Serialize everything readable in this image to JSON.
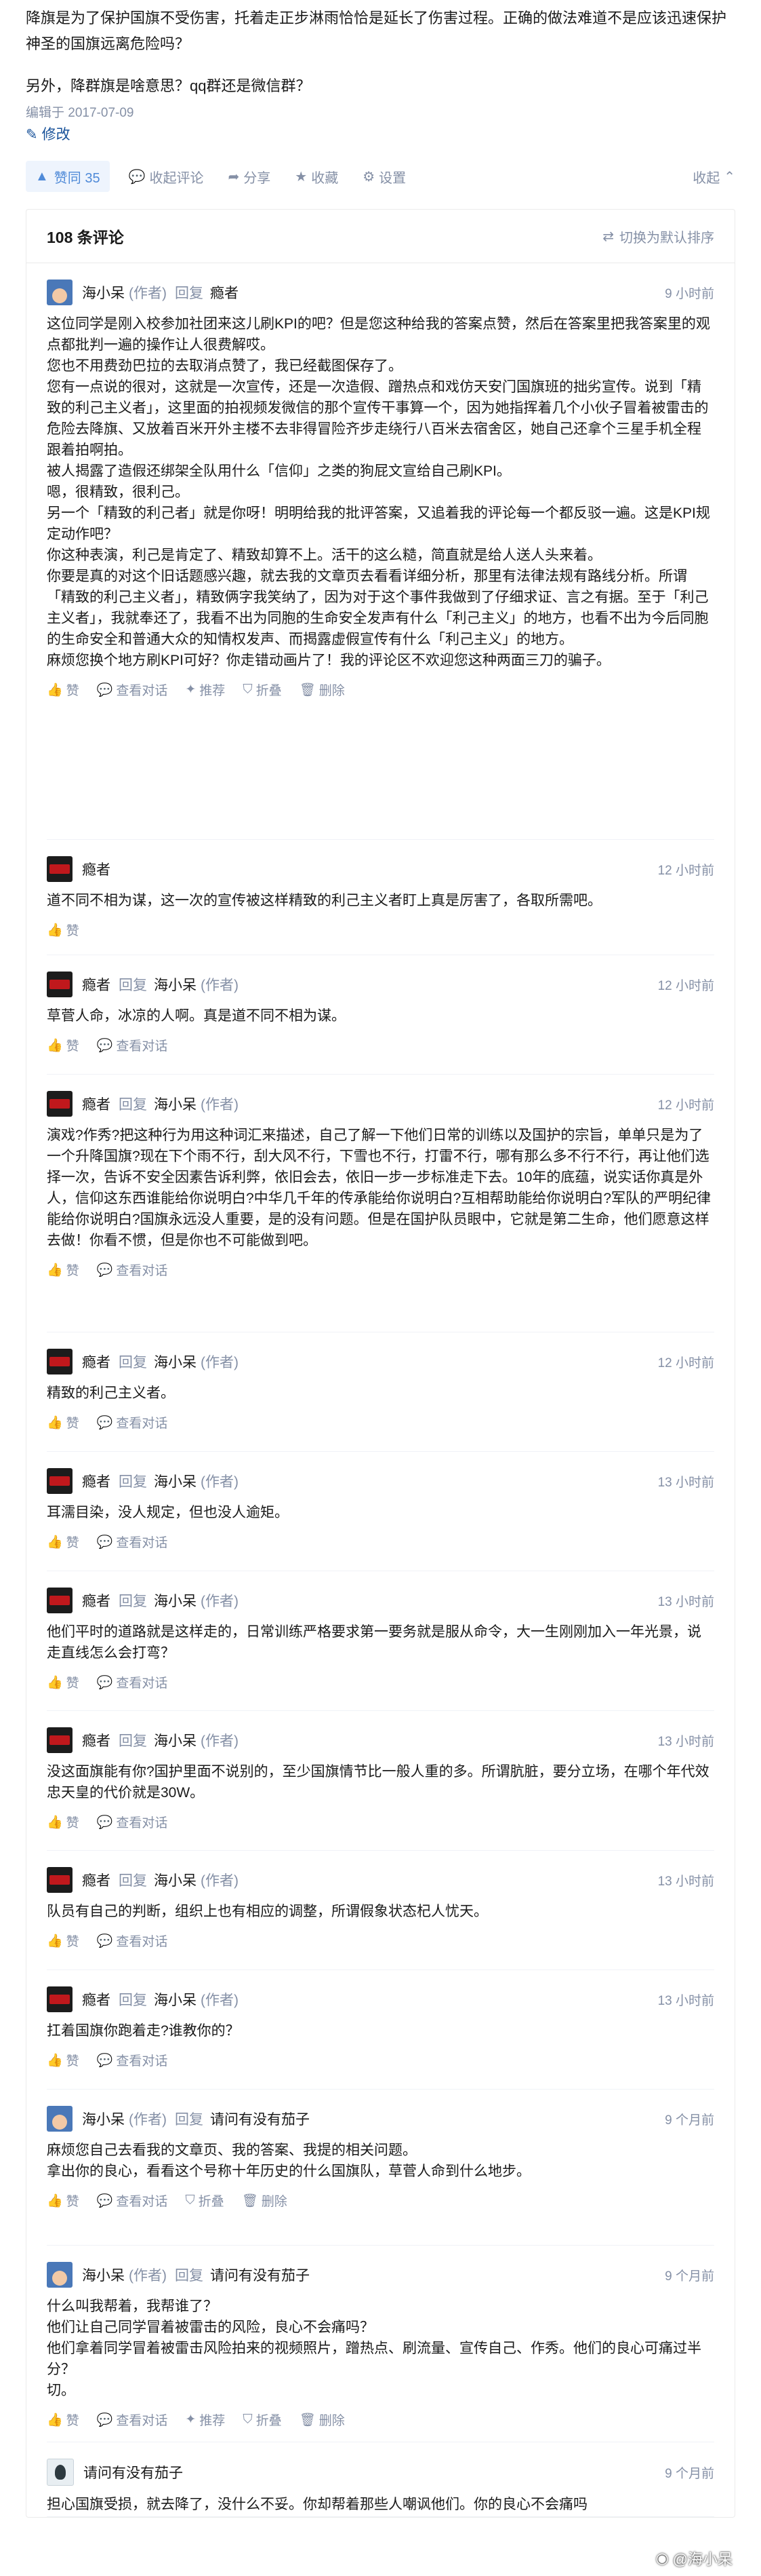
{
  "answer": {
    "para1": "降旗是为了保护国旗不受伤害，托着走正步淋雨恰恰是延长了伤害过程。正确的做法难道不是应该迅速保护神圣的国旗远离危险吗？",
    "para2": "另外，降群旗是啥意思？qq群还是微信群？",
    "edited": "编辑于 2017-07-09",
    "modify_label": "修改"
  },
  "actions": {
    "vote_label": "赞同 35",
    "comments_label": "收起评论",
    "share_label": "分享",
    "favorite_label": "收藏",
    "settings_label": "设置",
    "collapse_label": "收起"
  },
  "comments_header": {
    "count_label": "108 条评论",
    "sort_label": "切换为默认排序"
  },
  "labels": {
    "author_tag": "(作者)",
    "reply": "回复",
    "like": "赞",
    "view_conversation": "查看对话",
    "recommend": "推荐",
    "fold": "折叠",
    "delete": "删除"
  },
  "comments": [
    {
      "user": "海小呆",
      "is_author": true,
      "reply_to": "瘾者",
      "reply_to_author": false,
      "time": "9 小时前",
      "avatar": "xiao",
      "lines": [
        "这位同学是刚入校参加社团来这儿刷KPI的吧？但是您这种给我的答案点赞，然后在答案里把我答案里的观点都批判一遍的操作让人很费解哎。",
        "您也不用费劲巴拉的去取消点赞了，我已经截图保存了。",
        "您有一点说的很对，这就是一次宣传，还是一次造假、蹭热点和戏仿天安门国旗班的拙劣宣传。说到「精致的利己主义者」，这里面的拍视频发微信的那个宣传干事算一个，因为她指挥着几个小伙子冒着被雷击的危险去降旗、又放着百米开外主楼不去非得冒险齐步走绕行八百米去宿舍区，她自己还拿个三星手机全程跟着拍啊拍。",
        "被人揭露了造假还绑架全队用什么「信仰」之类的狗屁文宣给自己刷KPI。",
        "嗯，很精致，很利己。",
        "另一个「精致的利己者」就是你呀！明明给我的批评答案，又追着我的评论每一个都反驳一遍。这是KPI规定动作吧？",
        "你这种表演，利己是肯定了、精致却算不上。活干的这么糙，简直就是给人送人头来着。",
        "你要是真的对这个旧话题感兴趣，就去我的文章页去看看详细分析，那里有法律法规有路线分析。所谓「精致的利己主义者」，精致俩字我笑纳了，因为对于这个事件我做到了仔细求证、言之有据。至于「利己主义者」，我就奉还了，我看不出为同胞的生命安全发声有什么「利己主义」的地方，也看不出为今后同胞的生命安全和普通大众的知情权发声、而揭露虚假宣传有什么「利己主义」的地方。",
        "麻烦您换个地方刷KPI可好？你走错动画片了！我的评论区不欢迎您这种两面三刀的骗子。"
      ],
      "actions": [
        "like",
        "view_conversation",
        "recommend",
        "fold",
        "delete"
      ]
    },
    {
      "user": "瘾者",
      "is_author": false,
      "reply_to": "",
      "reply_to_author": false,
      "time": "12 小时前",
      "avatar": "chi",
      "lines": [
        "道不同不相为谋，这一次的宣传被这样精致的利己主义者盯上真是厉害了，各取所需吧。"
      ],
      "actions": [
        "like"
      ]
    },
    {
      "user": "瘾者",
      "is_author": false,
      "reply_to": "海小呆",
      "reply_to_author": true,
      "time": "12 小时前",
      "avatar": "chi",
      "lines": [
        "草菅人命，冰凉的人啊。真是道不同不相为谋。"
      ],
      "actions": [
        "like",
        "view_conversation"
      ]
    },
    {
      "user": "瘾者",
      "is_author": false,
      "reply_to": "海小呆",
      "reply_to_author": true,
      "time": "12 小时前",
      "avatar": "chi",
      "lines": [
        "演戏?作秀?把这种行为用这种词汇来描述，自己了解一下他们日常的训练以及国护的宗旨，单单只是为了一个升降国旗?现在下个雨不行，刮大风不行，下雪也不行，打雷不行，哪有那么多不行不行，再让他们选择一次，告诉不安全因素告诉利弊，依旧会去，依旧一步一步标准走下去。10年的底蕴，说实话你真是外人，信仰这东西谁能给你说明白?中华几千年的传承能给你说明白?互相帮助能给你说明白?军队的严明纪律能给你说明白?国旗永远没人重要，是的没有问题。但是在国护队员眼中，它就是第二生命，他们愿意这样去做！你看不惯，但是你也不可能做到吧。"
      ],
      "actions": [
        "like",
        "view_conversation"
      ]
    },
    {
      "user": "瘾者",
      "is_author": false,
      "reply_to": "海小呆",
      "reply_to_author": true,
      "time": "12 小时前",
      "avatar": "chi",
      "lines": [
        "精致的利己主义者。"
      ],
      "actions": [
        "like",
        "view_conversation"
      ]
    },
    {
      "user": "瘾者",
      "is_author": false,
      "reply_to": "海小呆",
      "reply_to_author": true,
      "time": "13 小时前",
      "avatar": "chi",
      "lines": [
        "耳濡目染，没人规定，但也没人逾矩。"
      ],
      "actions": [
        "like",
        "view_conversation"
      ]
    },
    {
      "user": "瘾者",
      "is_author": false,
      "reply_to": "海小呆",
      "reply_to_author": true,
      "time": "13 小时前",
      "avatar": "chi",
      "lines": [
        "他们平时的道路就是这样走的，日常训练严格要求第一要务就是服从命令，大一生刚刚加入一年光景，说走直线怎么会打弯？"
      ],
      "actions": [
        "like",
        "view_conversation"
      ]
    },
    {
      "user": "瘾者",
      "is_author": false,
      "reply_to": "海小呆",
      "reply_to_author": true,
      "time": "13 小时前",
      "avatar": "chi",
      "lines": [
        "没这面旗能有你?国护里面不说别的，至少国旗情节比一般人重的多。所谓肮脏，要分立场，在哪个年代效忠天皇的代价就是30W。"
      ],
      "actions": [
        "like",
        "view_conversation"
      ]
    },
    {
      "user": "瘾者",
      "is_author": false,
      "reply_to": "海小呆",
      "reply_to_author": true,
      "time": "13 小时前",
      "avatar": "chi",
      "lines": [
        "队员有自己的判断，组织上也有相应的调整，所谓假象状态杞人忧天。"
      ],
      "actions": [
        "like",
        "view_conversation"
      ]
    },
    {
      "user": "瘾者",
      "is_author": false,
      "reply_to": "海小呆",
      "reply_to_author": true,
      "time": "13 小时前",
      "avatar": "chi",
      "lines": [
        "扛着国旗你跑着走?谁教你的？"
      ],
      "actions": [
        "like",
        "view_conversation"
      ]
    },
    {
      "user": "海小呆",
      "is_author": true,
      "reply_to": "请问有没有茄子",
      "reply_to_author": false,
      "time": "9 个月前",
      "avatar": "xiao",
      "lines": [
        "麻烦您自己去看我的文章页、我的答案、我提的相关问题。",
        "拿出你的良心，看看这个号称十年历史的什么国旗队，草菅人命到什么地步。"
      ],
      "actions": [
        "like",
        "view_conversation",
        "fold",
        "delete"
      ]
    },
    {
      "user": "海小呆",
      "is_author": true,
      "reply_to": "请问有没有茄子",
      "reply_to_author": false,
      "time": "9 个月前",
      "avatar": "xiao",
      "lines": [
        "什么叫我帮着，我帮谁了？",
        "他们让自己同学冒着被雷击的风险，良心不会痛吗？",
        "他们拿着同学冒着被雷击风险拍来的视频照片，蹭热点、刷流量、宣传自己、作秀。他们的良心可痛过半分？",
        "切。"
      ],
      "actions": [
        "like",
        "view_conversation",
        "recommend",
        "fold",
        "delete"
      ]
    },
    {
      "user": "请问有没有茄子",
      "is_author": false,
      "reply_to": "",
      "reply_to_author": false,
      "time": "9 个月前",
      "avatar": "qing",
      "lines": [
        "担心国旗受损，就去降了，没什么不妥。你却帮着那些人嘲讽他们。你的良心不会痛吗"
      ],
      "actions": []
    }
  ],
  "watermark": "@海小呆"
}
